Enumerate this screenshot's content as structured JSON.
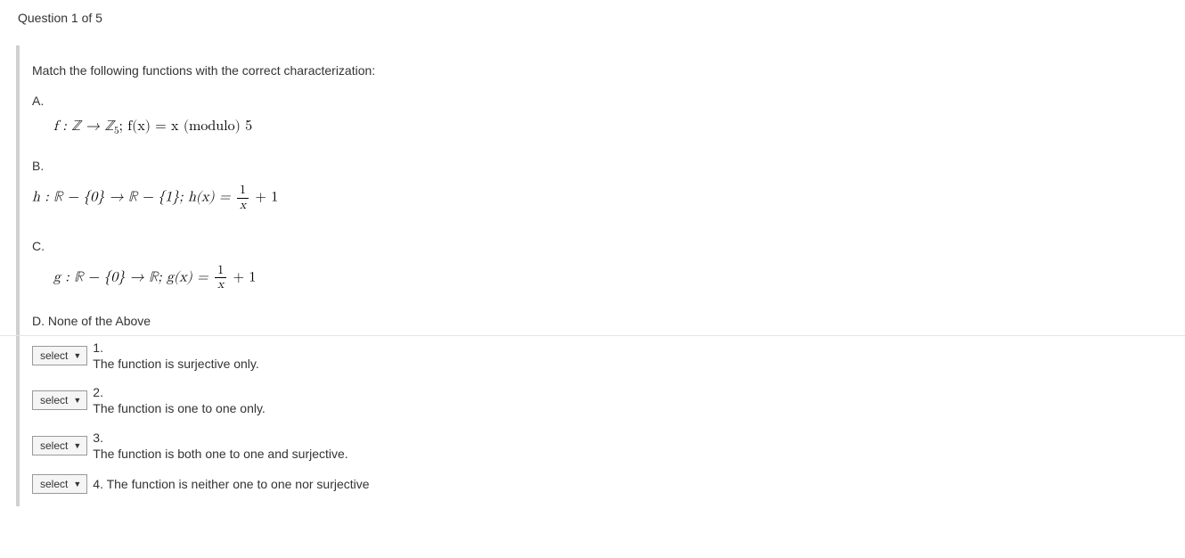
{
  "header": {
    "question_counter": "Question 1 of 5"
  },
  "question": {
    "instruction": "Match the following functions with the correct characterization:",
    "options": {
      "a_label": "A.",
      "b_label": "B.",
      "c_label": "C.",
      "d_label": "D. None of the Above"
    },
    "formulas": {
      "a_pre": "f : ℤ → ℤ",
      "a_sub": "5",
      "a_post": "; f(x) = x (modulo) 5",
      "b_pre": "h : ℝ − {0} → ℝ − {1};  h(x) = ",
      "b_frac_num": "1",
      "b_frac_den": "x",
      "b_post": " + 1",
      "c_pre": "g : ℝ − {0} → ℝ;  g(x) = ",
      "c_frac_num": "1",
      "c_frac_den": "x",
      "c_post": " + 1"
    }
  },
  "matching": {
    "select_label": "select",
    "items": [
      {
        "num": "1.",
        "desc": "The function is surjective only."
      },
      {
        "num": "2.",
        "desc": "The function is one to one only."
      },
      {
        "num": "3.",
        "desc": "The function is both one to one and surjective."
      },
      {
        "num": "4. The function is neither one to one nor surjective",
        "desc": ""
      }
    ]
  }
}
